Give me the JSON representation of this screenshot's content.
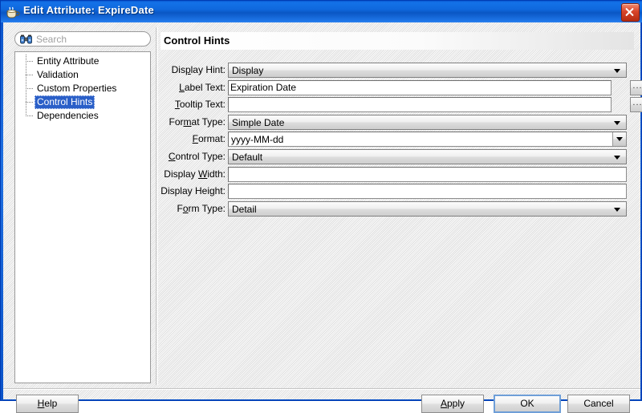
{
  "window": {
    "title": "Edit Attribute: ExpireDate",
    "icon": "coffee-cup-icon",
    "close_label": "close-icon",
    "title_bar_color": "#0a56c4",
    "close_button_color": "#d8442a"
  },
  "search": {
    "placeholder": "Search",
    "value": "",
    "icon": "binoculars-icon"
  },
  "tree": {
    "items": [
      {
        "label": "Entity Attribute",
        "selected": false
      },
      {
        "label": "Validation",
        "selected": false
      },
      {
        "label": "Custom Properties",
        "selected": false
      },
      {
        "label": "Control Hints",
        "selected": true
      },
      {
        "label": "Dependencies",
        "selected": false
      }
    ],
    "selection_color": "#2a5fc8"
  },
  "panel": {
    "title": "Control Hints"
  },
  "form": {
    "rows": [
      {
        "name": "display-hint",
        "label": "Display Hint:",
        "mnemonic_index": 3,
        "type": "combo",
        "value": "Display",
        "has_ellipsis": false
      },
      {
        "name": "label-text",
        "label": "Label Text:",
        "mnemonic_index": 0,
        "type": "text",
        "value": "Expiration Date",
        "has_ellipsis": true,
        "ellipsis_label": "..."
      },
      {
        "name": "tooltip-text",
        "label": "Tooltip Text:",
        "mnemonic_index": 0,
        "type": "text",
        "value": "",
        "has_ellipsis": true,
        "ellipsis_label": "..."
      },
      {
        "name": "format-type",
        "label": "Format Type:",
        "mnemonic_index": 3,
        "type": "combo",
        "value": "Simple Date",
        "has_ellipsis": false
      },
      {
        "name": "format",
        "label": "Format:",
        "mnemonic_index": 0,
        "type": "editable-combo",
        "value": "yyyy-MM-dd",
        "has_ellipsis": false
      },
      {
        "name": "control-type",
        "label": "Control Type:",
        "mnemonic_index": 0,
        "type": "combo",
        "value": "Default",
        "has_ellipsis": false
      },
      {
        "name": "display-width",
        "label": "Display Width:",
        "mnemonic_index": 8,
        "type": "text",
        "value": "",
        "has_ellipsis": false
      },
      {
        "name": "display-height",
        "label": "Display Height:",
        "mnemonic_index": -1,
        "type": "text",
        "value": "",
        "has_ellipsis": false
      },
      {
        "name": "form-type",
        "label": "Form Type:",
        "mnemonic_index": 1,
        "type": "combo",
        "value": "Detail",
        "has_ellipsis": false
      }
    ]
  },
  "buttons": {
    "help": {
      "label": "Help",
      "mnemonic_index": 0,
      "default": false
    },
    "apply": {
      "label": "Apply",
      "mnemonic_index": 0,
      "default": false
    },
    "ok": {
      "label": "OK",
      "mnemonic_index": -1,
      "default": true
    },
    "cancel": {
      "label": "Cancel",
      "mnemonic_index": -1,
      "default": false
    }
  }
}
